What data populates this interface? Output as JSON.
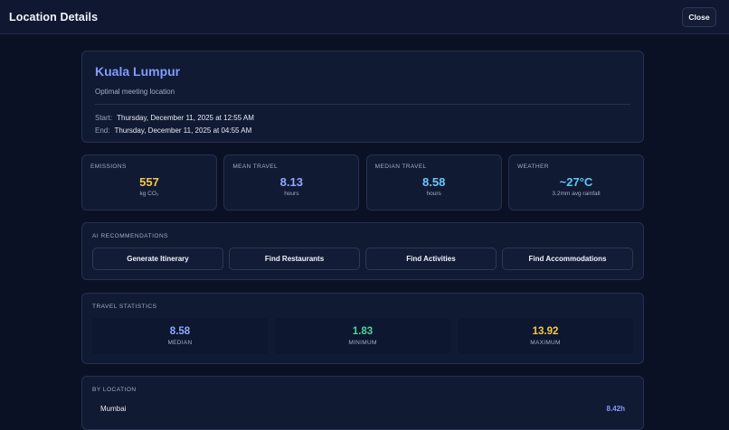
{
  "header": {
    "title": "Location Details",
    "close_label": "Close"
  },
  "location": {
    "name": "Kuala Lumpur",
    "subtitle": "Optimal meeting location",
    "start_label": "Start:",
    "start_value": "Thursday, December 11, 2025 at 12:55 AM",
    "end_label": "End:",
    "end_value": "Thursday, December 11, 2025 at 04:55 AM"
  },
  "metrics": [
    {
      "label": "EMISSIONS",
      "value": "557",
      "unit": "kg CO₂",
      "color": "#f5c84c"
    },
    {
      "label": "MEAN TRAVEL",
      "value": "8.13",
      "unit": "hours",
      "color": "#8fa6ff"
    },
    {
      "label": "MEDIAN TRAVEL",
      "value": "8.58",
      "unit": "hours",
      "color": "#6fc6ff"
    },
    {
      "label": "WEATHER",
      "value": "~27°C",
      "unit": "3.2mm avg rainfall",
      "color": "#5ec8f0"
    }
  ],
  "ai": {
    "label": "AI RECOMMENDATIONS",
    "buttons": [
      "Generate Itinerary",
      "Find Restaurants",
      "Find Activities",
      "Find Accommodations"
    ]
  },
  "stats": {
    "label": "TRAVEL STATISTICS",
    "items": [
      {
        "value": "8.58",
        "label": "MEDIAN",
        "color": "#8fa6ff"
      },
      {
        "value": "1.83",
        "label": "MINIMUM",
        "color": "#4fd39a"
      },
      {
        "value": "13.92",
        "label": "MAXIMUM",
        "color": "#f5c84c"
      }
    ]
  },
  "by_location": {
    "label": "BY LOCATION",
    "rows": [
      {
        "city": "Mumbai",
        "hours": "8.42h"
      }
    ]
  }
}
